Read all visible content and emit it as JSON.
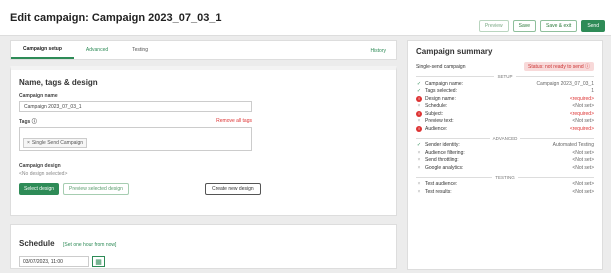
{
  "header": {
    "title": "Edit campaign: Campaign 2023_07_03_1",
    "buttons": {
      "preview": "Preview",
      "save": "Save",
      "save_exit": "Save & exit",
      "send": "Send"
    }
  },
  "tabs": {
    "setup": "Campaign setup",
    "advanced": "Advanced",
    "testing": "Testing",
    "history": "History"
  },
  "name_section": {
    "title": "Name, tags & design",
    "campaign_name_label": "Campaign name",
    "campaign_name_value": "Campaign 2023_07_03_1",
    "tags_label": "Tags ⓘ",
    "remove_all": "Remove all tags",
    "tag_chip": "Single Send Campaign",
    "design_label": "Campaign design",
    "design_hint": "<No design selected>",
    "select_design": "Select design",
    "preview_design": "Preview selected design",
    "create_design": "Create new design"
  },
  "schedule": {
    "title": "Schedule",
    "hint": "[Set one hour from now]",
    "date_value": "03/07/2023, 11:00"
  },
  "summary": {
    "title": "Campaign summary",
    "type": "Single-send campaign",
    "status": "Status: not ready to send ⓘ",
    "sections": {
      "setup": "SETUP",
      "advanced": "ADVANCED",
      "testing": "TESTING"
    },
    "setup_rows": [
      {
        "label": "Campaign name:",
        "value": "Campaign 2023_07_03_1",
        "state": "ok"
      },
      {
        "label": "Tags selected:",
        "value": "1",
        "state": "ok"
      },
      {
        "label": "Design name:",
        "value": "<required>",
        "state": "err"
      },
      {
        "label": "Schedule:",
        "value": "<Not set>",
        "state": "na"
      },
      {
        "label": "Subject:",
        "value": "<required>",
        "state": "err"
      },
      {
        "label": "Preview text:",
        "value": "<Not set>",
        "state": "na"
      },
      {
        "label": "Audience:",
        "value": "<required>",
        "state": "err"
      }
    ],
    "advanced_rows": [
      {
        "label": "Sender identity:",
        "value": "Automated Testing",
        "state": "ok"
      },
      {
        "label": "Audience filtering:",
        "value": "<Not set>",
        "state": "na"
      },
      {
        "label": "Send throttling:",
        "value": "<Not set>",
        "state": "na"
      },
      {
        "label": "Google analytics:",
        "value": "<Not set>",
        "state": "na"
      }
    ],
    "testing_rows": [
      {
        "label": "Test audience:",
        "value": "<Not set>",
        "state": "na"
      },
      {
        "label": "Test results:",
        "value": "<Not set>",
        "state": "na"
      }
    ]
  }
}
